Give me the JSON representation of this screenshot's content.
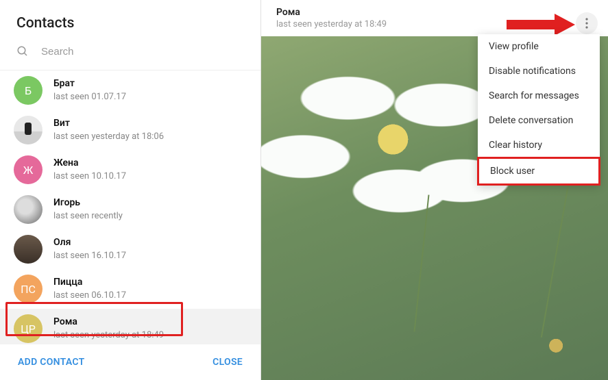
{
  "sidebar": {
    "title": "Contacts",
    "search_placeholder": "Search",
    "contacts": [
      {
        "name": "Брат",
        "status": "last seen 01.07.17",
        "avatar_type": "letter",
        "avatar_text": "Б",
        "avatar_class": "letter-b"
      },
      {
        "name": "Вит",
        "status": "last seen yesterday at 18:06",
        "avatar_type": "photo",
        "avatar_text": "",
        "avatar_class": "photo-vit"
      },
      {
        "name": "Жена",
        "status": "last seen 10.10.17",
        "avatar_type": "letter",
        "avatar_text": "Ж",
        "avatar_class": "letter-zh"
      },
      {
        "name": "Игорь",
        "status": "last seen recently",
        "avatar_type": "photo",
        "avatar_text": "",
        "avatar_class": "photo-igor"
      },
      {
        "name": "Оля",
        "status": "last seen 16.10.17",
        "avatar_type": "photo",
        "avatar_text": "",
        "avatar_class": "photo-olya"
      },
      {
        "name": "Пицца",
        "status": "last seen 06.10.17",
        "avatar_type": "letter",
        "avatar_text": "ПС",
        "avatar_class": "letter-ps"
      },
      {
        "name": "Рома",
        "status": "last seen yesterday at 18:49",
        "avatar_type": "letter",
        "avatar_text": "ЦР",
        "avatar_class": "letter-cr",
        "selected": true
      }
    ],
    "add_contact_label": "ADD CONTACT",
    "close_label": "CLOSE"
  },
  "chat": {
    "title": "Рома",
    "status": "last seen yesterday at 18:49",
    "menu": [
      "View profile",
      "Disable notifications",
      "Search for messages",
      "Delete conversation",
      "Clear history",
      "Block user"
    ],
    "menu_highlight_index": 5
  },
  "annotation": {
    "arrow_color": "#e02020",
    "highlight_color": "#e02020"
  }
}
